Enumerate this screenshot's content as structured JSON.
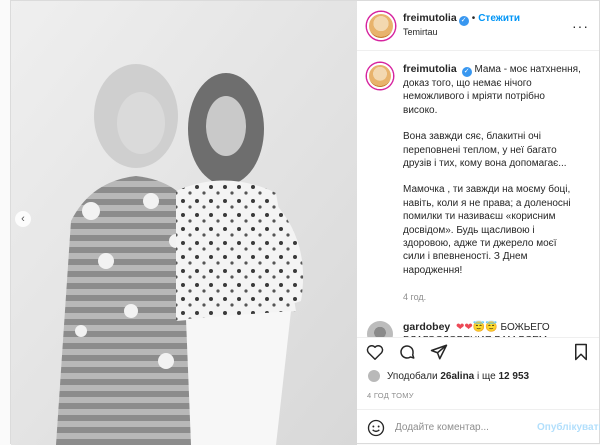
{
  "post": {
    "username": "freimutolia",
    "follow_label": "Стежити",
    "dot": "•",
    "location": "Temirtau",
    "caption_paragraphs": [
      "Мама - моє натхнення, доказ того, що немає нічого неможливого і мріяти потрібно високо.",
      "Вона завжди сяє, блакитні очі переповнені теплом, у неї багато друзів і тих, кому вона допомагає...",
      "Мамочка , ти завжди на моєму боці, навіть, коли я не права; а доленосні помилки ти називаєш «корисним досвідом». Будь щасливою і здоровою, адже ти джерело моєї сили і впевненості. З Днем народження!"
    ],
    "caption_age": "4 год.",
    "comment": {
      "username": "gardobey",
      "emojis": "❤❤😇😇",
      "text": "БОЖЬЕГО БЛАГОСЛОВЕНИЯ ВАМ ВСЕМ",
      "trailing_heart": "♥"
    },
    "likes_prefix": "Уподобали",
    "likes_user": "26alina",
    "likes_middle": "і ще",
    "likes_count": "12 953",
    "post_time": "4 ГОД ТОМУ",
    "comment_placeholder": "Додайте коментар...",
    "publish_label": "Опублікувати",
    "more_icon": "···",
    "carousel_arrow": "‹"
  },
  "colors": {
    "accent": "#0095f6",
    "verified": "#3897f0",
    "heart": "#ed4956"
  }
}
